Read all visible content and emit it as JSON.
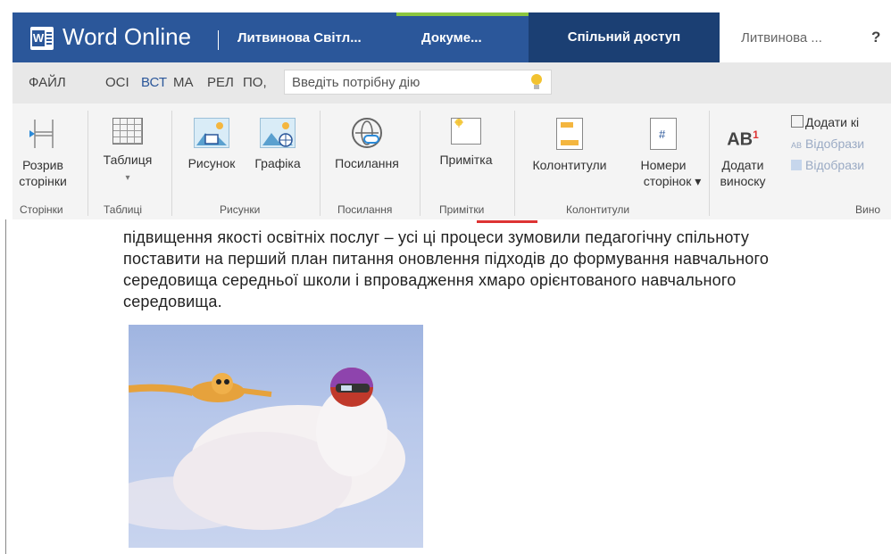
{
  "titlebar": {
    "app_name": "Word Online",
    "user_short": "Литвинова Світл...",
    "document_name": "Докуме...",
    "share_label": "Спільний доступ",
    "user_name": "Литвинова ...",
    "help_label": "?"
  },
  "tabs": {
    "items": [
      {
        "label": "ФАЙЛ"
      },
      {
        "label": "ОСІ"
      },
      {
        "label": "ВСТ"
      },
      {
        "label": "МА"
      },
      {
        "label": "РЕЛ"
      },
      {
        "label": "ПО,"
      }
    ],
    "active_index": 2,
    "tell_me_placeholder": "Введіть потрібну дію"
  },
  "ribbon": {
    "groups": [
      {
        "label": "Сторінки"
      },
      {
        "label": "Таблиці"
      },
      {
        "label": "Рисунки"
      },
      {
        "label": "Посилання"
      },
      {
        "label": "Примітки"
      },
      {
        "label": "Колонтитули"
      },
      {
        "label": "Вино"
      }
    ],
    "buttons": {
      "page_break_1": "Розрив",
      "page_break_2": "сторінки",
      "table": "Таблиця",
      "table_caret": "▾",
      "picture": "Рисунок",
      "graphics": "Графіка",
      "link": "Посилання",
      "comment": "Примітка",
      "header_footer": "Колонтитули",
      "page_numbers_1": "Номери",
      "page_numbers_2": "сторінок ▾",
      "footnote_1": "Додати",
      "footnote_2": "виноску",
      "endnote": "Додати кі",
      "show_1": "Відобрази",
      "show_2": "Відобрази",
      "ab_label": "AB"
    }
  },
  "document": {
    "lines": [
      "підвищення якості освітніх послуг – усі ці процеси зумовили педагогічну спільноту",
      "поставити на перший план питання оновлення підходів до формування навчального",
      "середовища середньої школи і впровадження хмаро орієнтованого навчального",
      "середовища."
    ]
  },
  "colors": {
    "brand": "#2b579a",
    "share_bg": "#1b3f73",
    "progress": "#8cc63f"
  }
}
